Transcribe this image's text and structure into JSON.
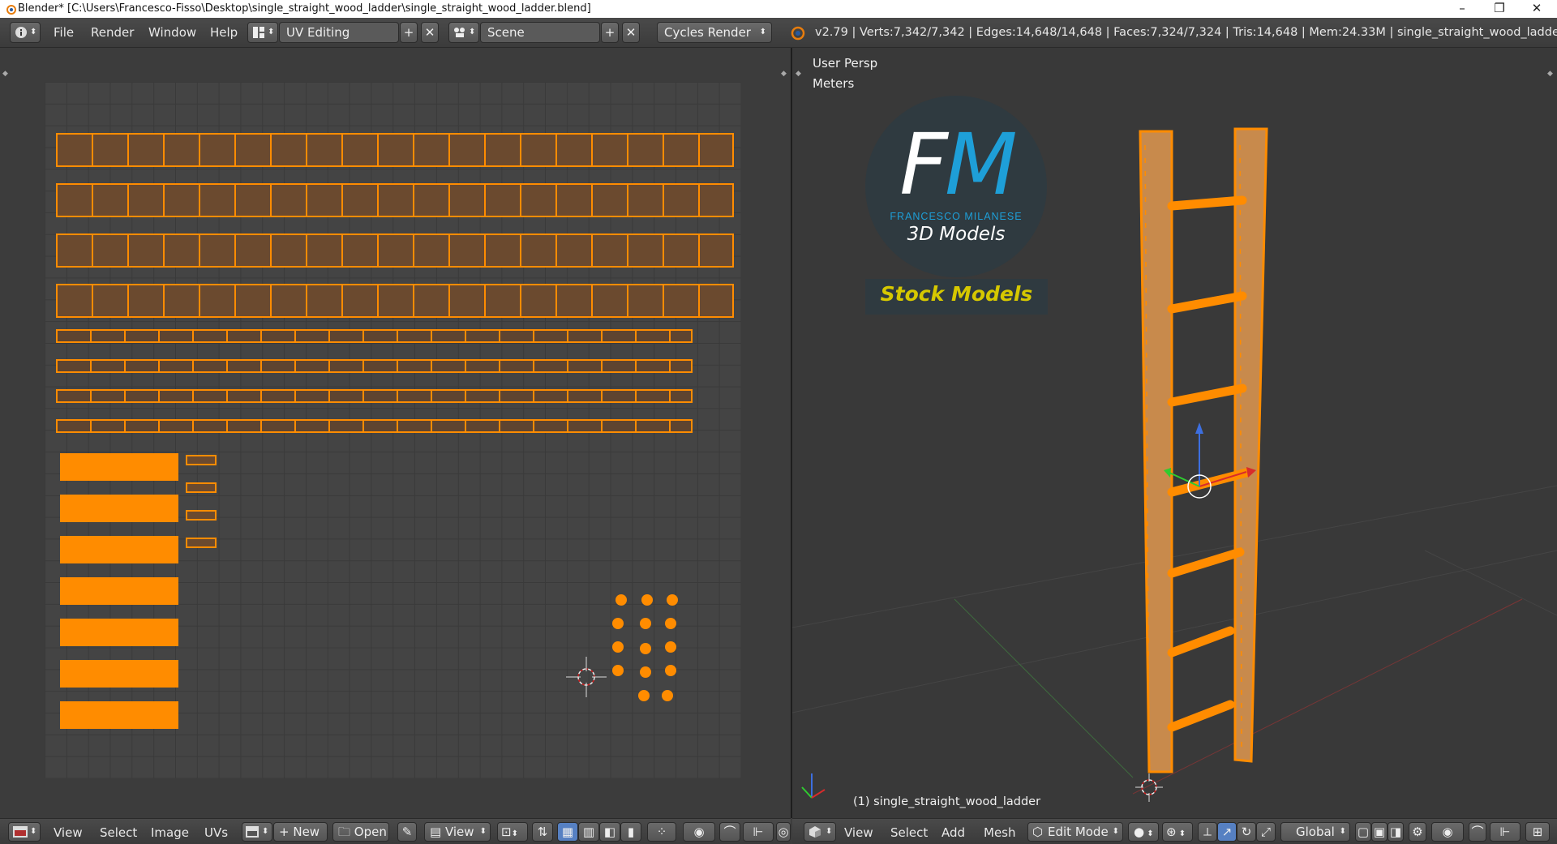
{
  "window": {
    "title": "Blender* [C:\\Users\\Francesco-Fisso\\Desktop\\single_straight_wood_ladder\\single_straight_wood_ladder.blend]",
    "minimize": "–",
    "restore": "❐",
    "close": "✕"
  },
  "topbar": {
    "menus": [
      "File",
      "Render",
      "Window",
      "Help"
    ],
    "screen_layout": "UV Editing",
    "scene": "Scene",
    "render_engine": "Cycles Render",
    "stats": "v2.79 | Verts:7,342/7,342 | Edges:14,648/14,648 | Faces:7,324/7,324 | Tris:14,648 | Mem:24.33M | single_straight_wood_ladder"
  },
  "viewport": {
    "view_name": "User Persp",
    "units": "Meters",
    "object_label": "(1) single_straight_wood_ladder",
    "logo": {
      "letters": "FM",
      "author": "FRANCESCO MILANESE",
      "tagline": "3D Models",
      "banner": "Stock Models"
    }
  },
  "uv_header": {
    "menus": [
      "View",
      "Select",
      "Image",
      "UVs"
    ],
    "new_label": "New",
    "open_label": "Open",
    "view_label": "View"
  },
  "view3d_header": {
    "menus": [
      "View",
      "Select",
      "Add",
      "Mesh"
    ],
    "mode": "Edit Mode",
    "orientation": "Global"
  },
  "colors": {
    "selection": "#ff8c00",
    "background": "#3d3d3d",
    "logo_blue": "#1e9fd8",
    "banner_text": "#d6c800"
  }
}
